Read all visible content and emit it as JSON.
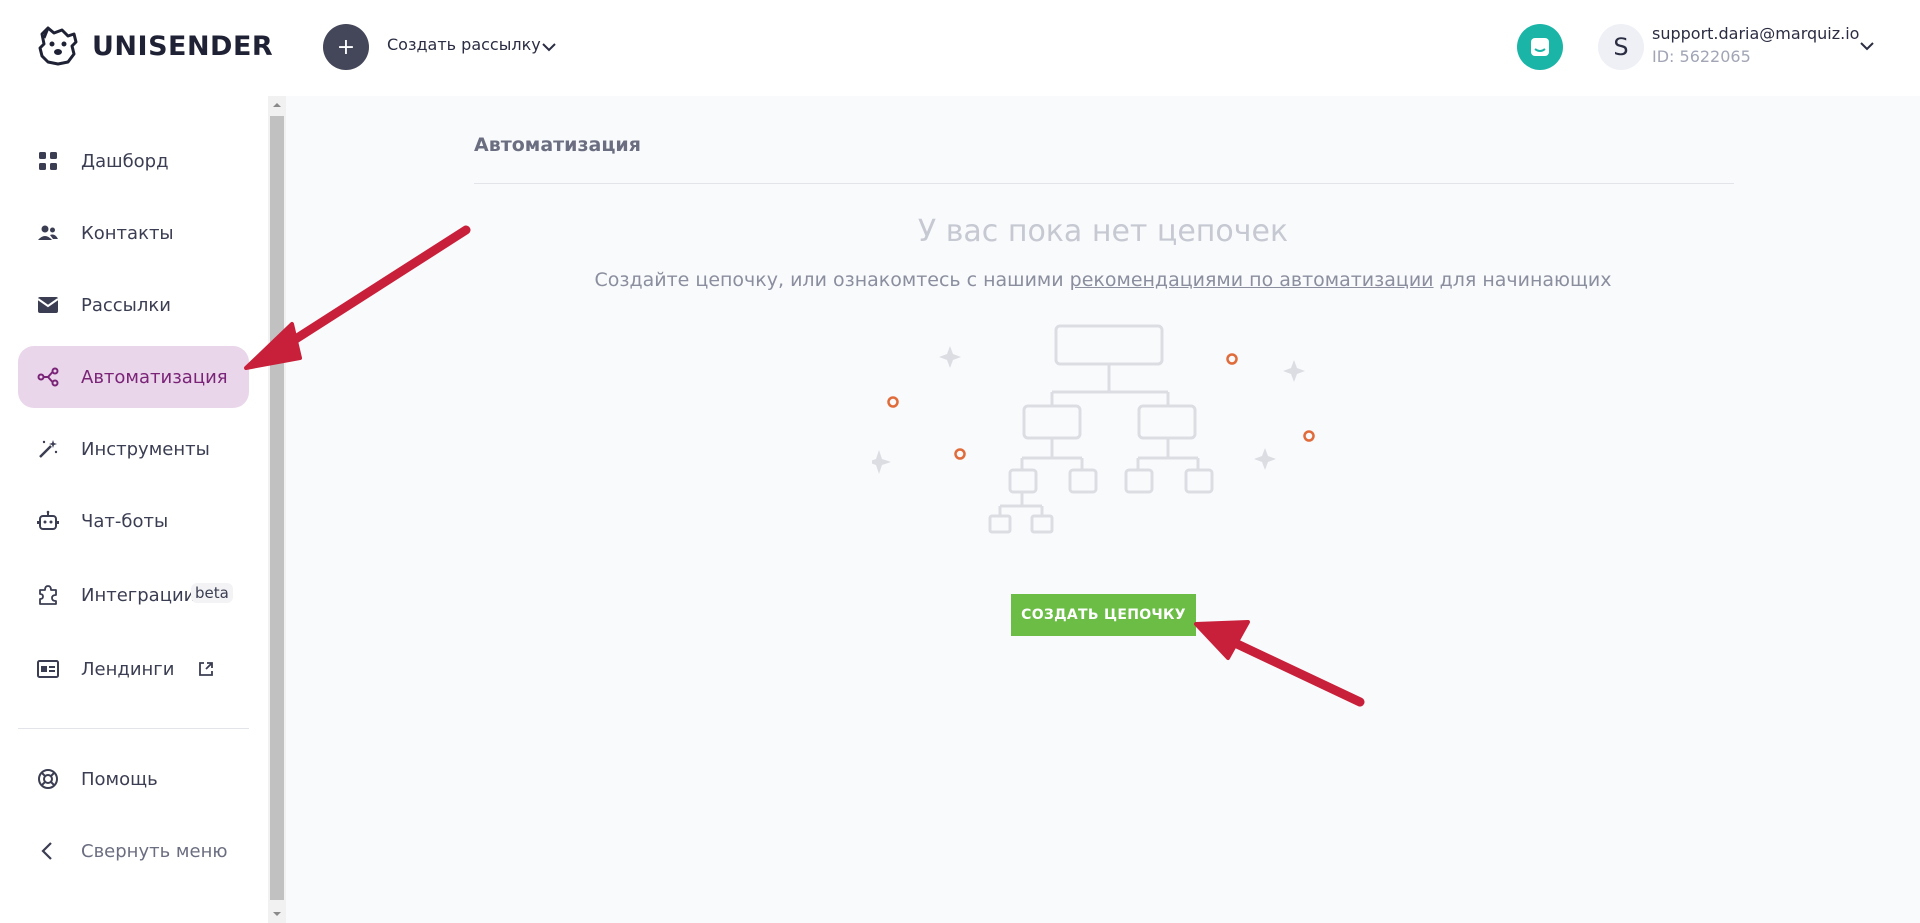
{
  "brand": {
    "name": "UNISENDER"
  },
  "header": {
    "create_button_symbol": "+",
    "create_label": "Создать рассылку",
    "account": {
      "avatar_letter": "S",
      "email": "support.daria@marquiz.io",
      "id": "ID: 5622065"
    }
  },
  "sidebar": {
    "items": [
      {
        "label": "Дашборд",
        "icon": "dashboard-icon"
      },
      {
        "label": "Контакты",
        "icon": "contacts-icon"
      },
      {
        "label": "Рассылки",
        "icon": "mail-icon"
      },
      {
        "label": "Автоматизация",
        "icon": "automation-icon",
        "active": true
      },
      {
        "label": "Инструменты",
        "icon": "magic-wand-icon"
      },
      {
        "label": "Чат-боты",
        "icon": "robot-icon"
      },
      {
        "label": "Интеграции",
        "icon": "puzzle-icon",
        "badge": "beta"
      },
      {
        "label": "Лендинги",
        "icon": "landing-icon",
        "external": true
      }
    ],
    "footer": [
      {
        "label": "Помощь",
        "icon": "help-icon"
      },
      {
        "label": "Свернуть меню",
        "icon": "chevron-left-icon"
      }
    ]
  },
  "main": {
    "title": "Автоматизация",
    "empty_heading": "У вас пока нет цепочек",
    "empty_sub_before": "Создайте цепочку, или ознакомтесь с нашими ",
    "empty_sub_link": "рекомендациями по автоматизации",
    "empty_sub_after": " для начинающих",
    "cta_label": "СОЗДАТЬ ЦЕПОЧКУ"
  },
  "colors": {
    "active_bg": "#ead6ea",
    "active_text": "#7a2478",
    "cta": "#6bbd46",
    "chat": "#1bb5a7",
    "annotation_arrow": "#c8203a"
  }
}
